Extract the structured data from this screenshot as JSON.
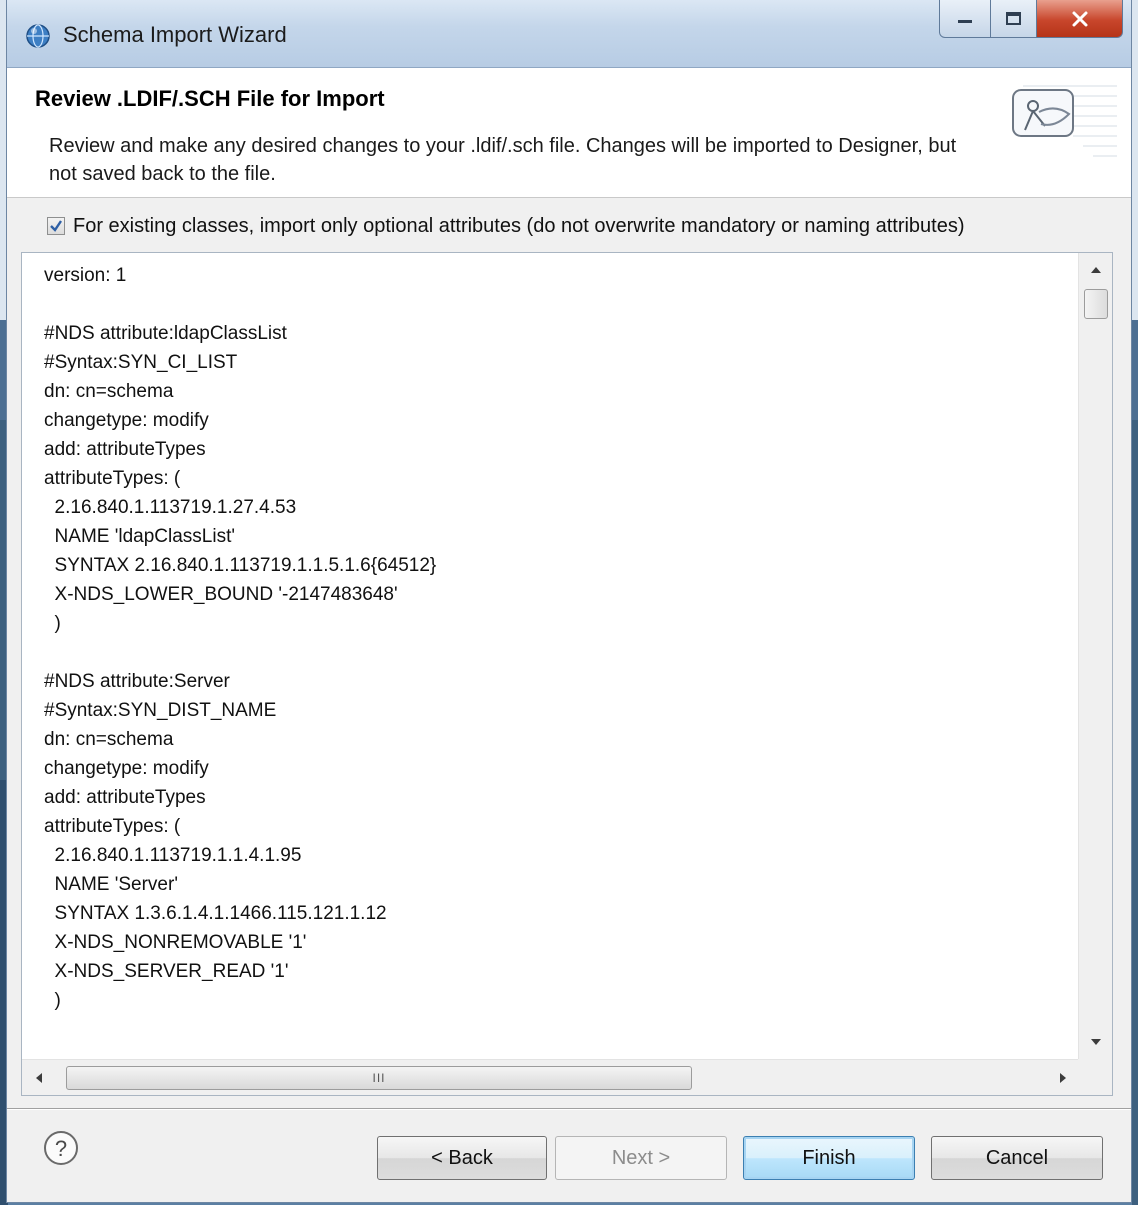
{
  "window": {
    "title": "Schema Import Wizard"
  },
  "header": {
    "title": "Review .LDIF/.SCH File for Import",
    "description": "Review and make any desired changes to your .ldif/.sch file.  Changes will be imported to Designer, but not saved back to the file."
  },
  "option": {
    "checked": true,
    "label": "For existing classes, import only optional attributes (do not overwrite mandatory or naming attributes)"
  },
  "editor": {
    "content": "version: 1\n\n#NDS attribute:ldapClassList\n#Syntax:SYN_CI_LIST\ndn: cn=schema\nchangetype: modify\nadd: attributeTypes\nattributeTypes: (\n  2.16.840.1.113719.1.27.4.53\n  NAME 'ldapClassList'\n  SYNTAX 2.16.840.1.113719.1.1.5.1.6{64512}\n  X-NDS_LOWER_BOUND '-2147483648'\n  )\n\n#NDS attribute:Server\n#Syntax:SYN_DIST_NAME\ndn: cn=schema\nchangetype: modify\nadd: attributeTypes\nattributeTypes: (\n  2.16.840.1.113719.1.1.4.1.95\n  NAME 'Server'\n  SYNTAX 1.3.6.1.4.1.1466.115.121.1.12\n  X-NDS_NONREMOVABLE '1'\n  X-NDS_SERVER_READ '1'\n  )",
    "hscroll_grip": "III"
  },
  "buttons": {
    "back": "< Back",
    "next": "Next >",
    "finish": "Finish",
    "cancel": "Cancel",
    "help": "?"
  },
  "colors": {
    "close_button": "#c8462c",
    "default_button_border": "#3c7fb1"
  },
  "icons": {
    "app": "app-globe-icon",
    "banner": "wizard-banner-icon",
    "help": "help-icon"
  }
}
